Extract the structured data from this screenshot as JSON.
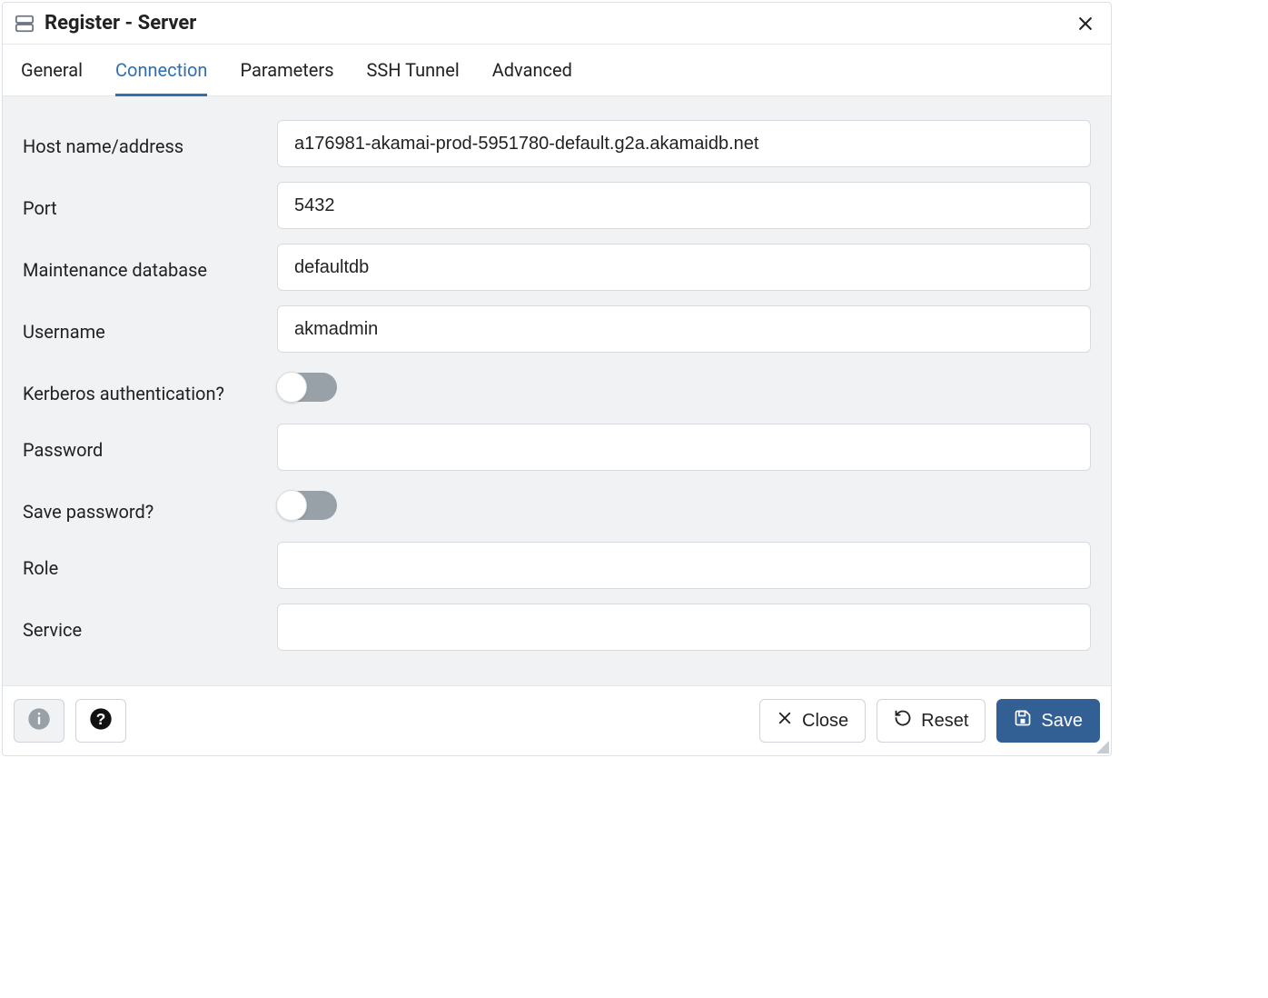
{
  "header": {
    "title": "Register - Server"
  },
  "tabs": [
    {
      "label": "General",
      "active": false
    },
    {
      "label": "Connection",
      "active": true
    },
    {
      "label": "Parameters",
      "active": false
    },
    {
      "label": "SSH Tunnel",
      "active": false
    },
    {
      "label": "Advanced",
      "active": false
    }
  ],
  "form": {
    "host_label": "Host name/address",
    "host_value": "a176981-akamai-prod-5951780-default.g2a.akamaidb.net",
    "port_label": "Port",
    "port_value": "5432",
    "maintdb_label": "Maintenance database",
    "maintdb_value": "defaultdb",
    "username_label": "Username",
    "username_value": "akmadmin",
    "kerberos_label": "Kerberos authentication?",
    "kerberos_on": false,
    "password_label": "Password",
    "password_value": "",
    "savepw_label": "Save password?",
    "savepw_on": false,
    "role_label": "Role",
    "role_value": "",
    "service_label": "Service",
    "service_value": ""
  },
  "footer": {
    "close": "Close",
    "reset": "Reset",
    "save": "Save"
  }
}
